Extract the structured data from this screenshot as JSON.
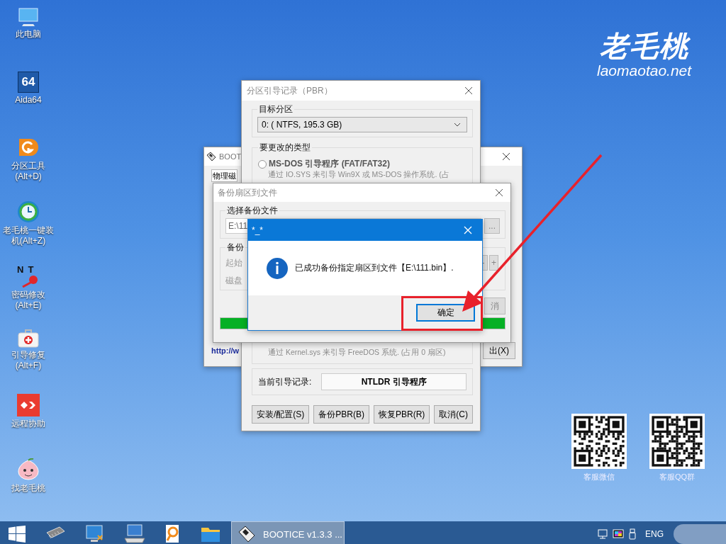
{
  "desktop_icons": [
    {
      "label": "此电脑",
      "kind": "computer"
    },
    {
      "label": "Aida64",
      "kind": "aida",
      "icon_text": "64"
    },
    {
      "label": "分区工具\n(Alt+D)",
      "kind": "partition"
    },
    {
      "label": "老毛桃一键装机(Alt+Z)",
      "kind": "installer"
    },
    {
      "label": "密码修改\n(Alt+E)",
      "kind": "password",
      "icon_text": "NT"
    },
    {
      "label": "引导修复\n(Alt+F)",
      "kind": "repair"
    },
    {
      "label": "远程协助",
      "kind": "remote"
    },
    {
      "label": "找老毛桃",
      "kind": "mascot"
    }
  ],
  "logo": {
    "name": "老毛桃",
    "url": "laomaotao.net"
  },
  "qr_codes": [
    {
      "caption": "客服微信"
    },
    {
      "caption": "客服QQ群"
    }
  ],
  "bootice_window": {
    "title": "BOOT",
    "tab": "物理磁",
    "link": "http://w",
    "exit_button": "出(X)"
  },
  "pbr_window": {
    "title": "分区引导记录（PBR）",
    "target_group": "目标分区",
    "partition": "0: ( NTFS, 195.3 GB)",
    "type_group": "要更改的类型",
    "options": [
      {
        "label": "MS-DOS 引导程序 (FAT/FAT32)",
        "description": "通过 IO.SYS 来引导 Win9X 或 MS-DOS 操作系统. (占",
        "selected": false
      }
    ],
    "last_description": "通过 Kernel.sys 来引导 FreeDOS 系统. (占用 0 扇区)",
    "current_label": "当前引导记录:",
    "current_value": "NTLDR 引导程序",
    "buttons": [
      "安装/配置(S)",
      "备份PBR(B)",
      "恢复PBR(R)",
      "取消(C)"
    ]
  },
  "backup_window": {
    "title": "备份扇区到文件",
    "file_group": "选择备份文件",
    "file_path": "E:\\11",
    "browse_button": "...",
    "sector_group": "备份",
    "labels": [
      "起始",
      "磁盘"
    ],
    "step_buttons": [
      "-",
      "+"
    ],
    "cancel_button": "消",
    "progress": {
      "level": 1
    }
  },
  "message_box": {
    "title": "*_*",
    "message": "已成功备份指定扇区到文件【E:\\111.bin】.",
    "ok_button": "确定"
  },
  "taskbar": {
    "active_task": {
      "label": "BOOTICE v1.3.3 ...",
      "selected": true
    },
    "language": "ENG"
  }
}
